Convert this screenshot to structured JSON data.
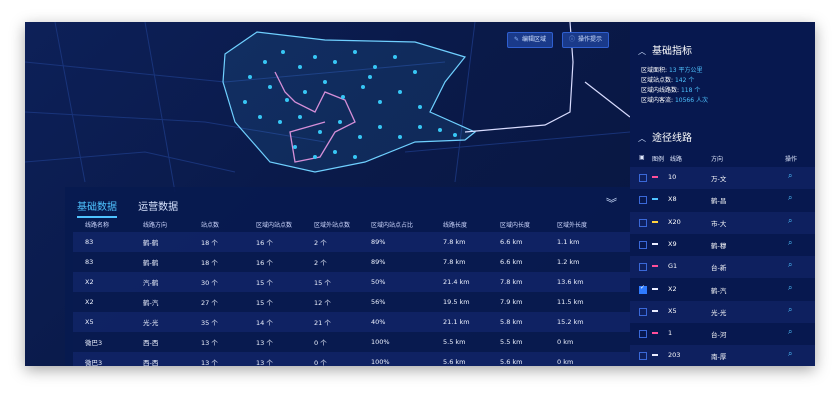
{
  "map": {
    "edit_area_label": "编辑区域",
    "help_label": "操作提示",
    "edit_icon": "pencil-icon",
    "help_icon": "info-circle-icon",
    "accent": "#4fc3ff",
    "route_color": "#d58fd8"
  },
  "bottom_panel": {
    "tabs": [
      {
        "label": "基础数据",
        "active": true
      },
      {
        "label": "运营数据",
        "active": false
      }
    ],
    "collapse_icon": "double-chevron-down-icon",
    "columns": [
      "线路名称",
      "线路方向",
      "站点数",
      "区域内站点数",
      "区域外站点数",
      "区域内站点占比",
      "线路长度",
      "区域内长度",
      "区域外长度"
    ],
    "rows": [
      [
        "83",
        "鹤-鹤",
        "18 个",
        "16 个",
        "2 个",
        "89%",
        "7.8 km",
        "6.6 km",
        "1.1 km"
      ],
      [
        "83",
        "鹤-鹤",
        "18 个",
        "16 个",
        "2 个",
        "89%",
        "7.8 km",
        "6.6 km",
        "1.2 km"
      ],
      [
        "X2",
        "汽-鹤",
        "30 个",
        "15 个",
        "15 个",
        "50%",
        "21.4 km",
        "7.8 km",
        "13.6 km"
      ],
      [
        "X2",
        "鹤-汽",
        "27 个",
        "15 个",
        "12 个",
        "56%",
        "19.5 km",
        "7.9 km",
        "11.5 km"
      ],
      [
        "X5",
        "光-光",
        "35 个",
        "14 个",
        "21 个",
        "40%",
        "21.1 km",
        "5.8 km",
        "15.2 km"
      ],
      [
        "微巴3",
        "西-西",
        "13 个",
        "13 个",
        "0 个",
        "100%",
        "5.5 km",
        "5.5 km",
        "0 km"
      ],
      [
        "微巴3",
        "西-西",
        "13 个",
        "13 个",
        "0 个",
        "100%",
        "5.6 km",
        "5.6 km",
        "0 km"
      ]
    ]
  },
  "side": {
    "basic_title": "基础指标",
    "metrics": [
      {
        "label": "区域面积:",
        "value": "13 平方公里"
      },
      {
        "label": "区域站点数:",
        "value": "142 个"
      },
      {
        "label": "区域内线路数:",
        "value": "118 个"
      },
      {
        "label": "区域内客流:",
        "value": "10566 人次"
      }
    ],
    "route_title": "途径线路",
    "route_headers": {
      "legend": "图例",
      "line": "线路",
      "dir": "方向",
      "op": "操作"
    },
    "routes": [
      {
        "name": "10",
        "dir": "万-文",
        "color": "#ff4f9a",
        "checked": false
      },
      {
        "name": "X8",
        "dir": "鹤-昌",
        "color": "#4fc3ff",
        "checked": false
      },
      {
        "name": "X20",
        "dir": "市-大",
        "color": "#ffd23f",
        "checked": false
      },
      {
        "name": "X9",
        "dir": "鹤-穆",
        "color": "#e9ecff",
        "checked": false
      },
      {
        "name": "G1",
        "dir": "台-新",
        "color": "#ff4f9a",
        "checked": false
      },
      {
        "name": "X2",
        "dir": "鹤-汽",
        "color": "#e9ecff",
        "checked": true
      },
      {
        "name": "X5",
        "dir": "光-光",
        "color": "#e9ecff",
        "checked": false
      },
      {
        "name": "1",
        "dir": "台-河",
        "color": "#ff4f9a",
        "checked": false
      },
      {
        "name": "203",
        "dir": "南-厚",
        "color": "#e9ecff",
        "checked": false
      }
    ],
    "op_icon": "locate-icon",
    "op_glyph": "⌕"
  }
}
